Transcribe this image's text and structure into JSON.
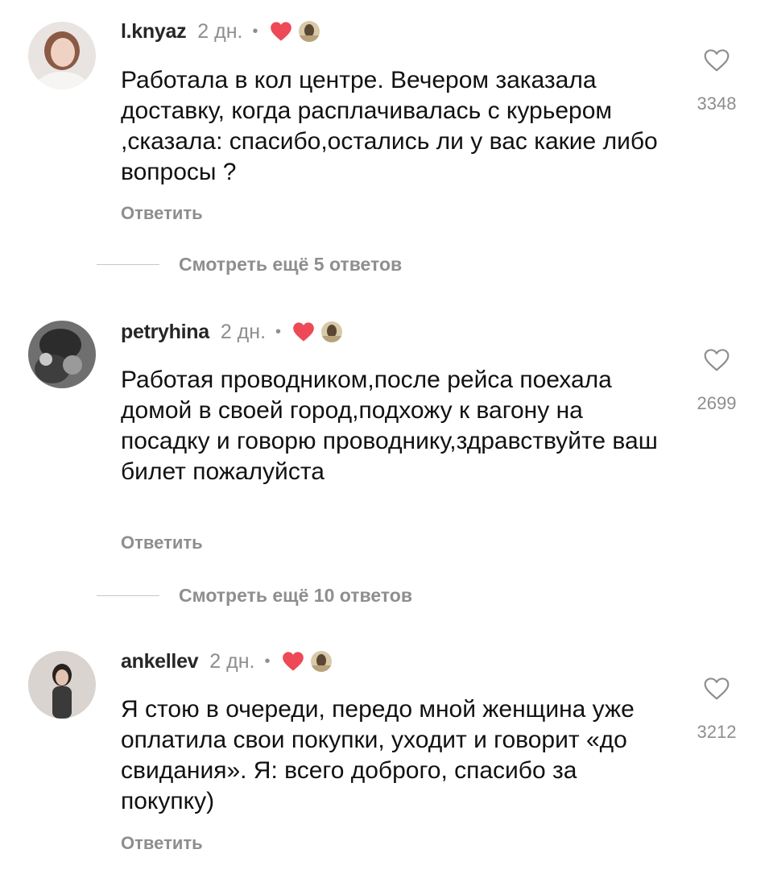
{
  "comments": [
    {
      "username": "l.knyaz",
      "time": "2 дн.",
      "dot": "•",
      "text": "Работала в кол центре. Вечером заказала доставку, когда расплачивалась с курьером ,сказала: спасибо,остались ли у вас какие либо вопросы ?",
      "reply_label": "Ответить",
      "likes": "3348",
      "view_replies": "Смотреть ещё 5 ответов"
    },
    {
      "username": "petryhina",
      "time": "2 дн.",
      "dot": "•",
      "text": "Работая проводником,после рейса поехала домой в своей город,подхожу к вагону на посадку и говорю проводнику,здравствуйте ваш билет пожалуйста",
      "reply_label": "Ответить",
      "likes": "2699",
      "view_replies": "Смотреть ещё 10 ответов"
    },
    {
      "username": "ankellev",
      "time": "2 дн.",
      "dot": "•",
      "text": "Я стою в очереди, передо мной женщина уже оплатила свои покупки, уходит и говорит «до свидания». Я: всего доброго, спасибо за покупку)",
      "reply_label": "Ответить",
      "likes": "3212"
    }
  ],
  "colors": {
    "heart_red": "#ed4956",
    "muted": "#8e8e8e",
    "text": "#111111"
  },
  "icons": {
    "like": "heart-outline-icon",
    "author_liked": "heart-filled-icon"
  }
}
